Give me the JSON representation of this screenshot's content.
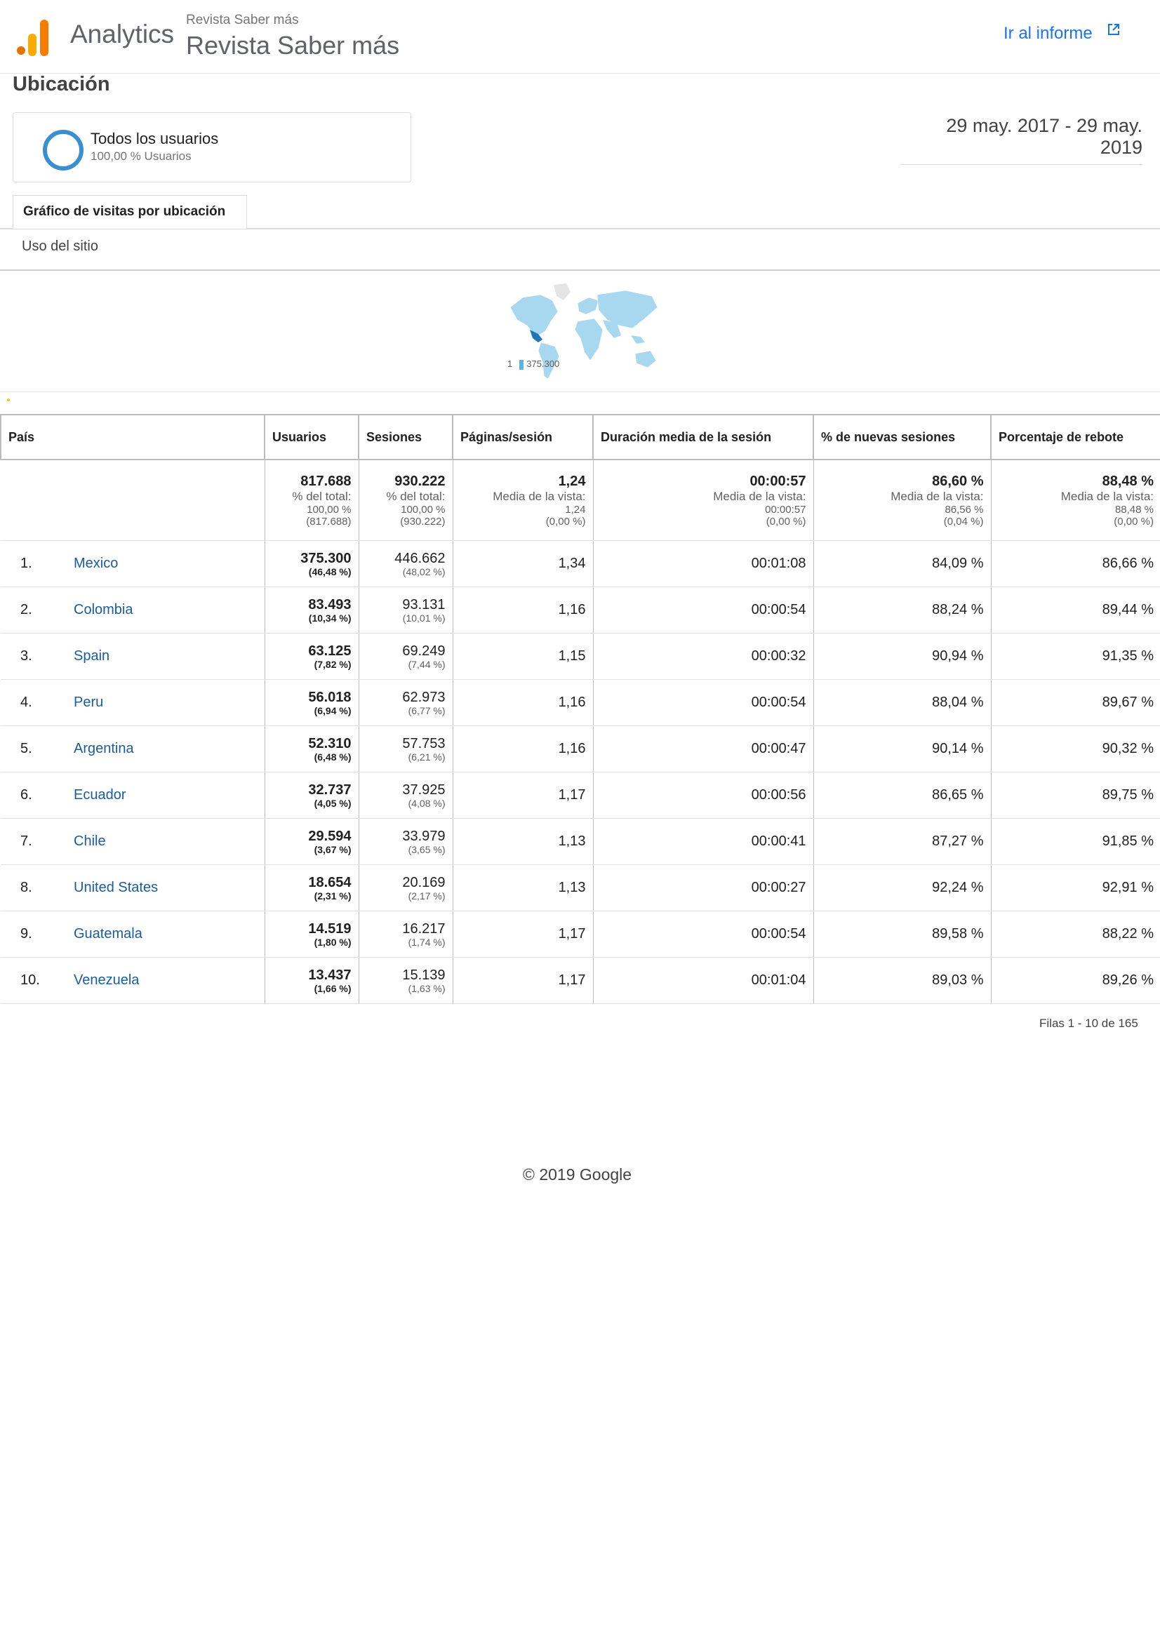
{
  "header": {
    "brand": "Analytics",
    "account_small": "Revista Saber más",
    "account_big": "Revista Saber más",
    "report_link": "Ir al informe"
  },
  "page_title": "Ubicación",
  "segment": {
    "name": "Todos los usuarios",
    "sub": "100,00 % Usuarios"
  },
  "date_range": "29 may. 2017 - 29 may. 2019",
  "tab": "Gráfico de visitas por ubicación",
  "subtab": "Uso del sitio",
  "map_legend": {
    "min": "1",
    "max": "375.300"
  },
  "table": {
    "headers": [
      "País",
      "Usuarios",
      "Sesiones",
      "Páginas/sesión",
      "Duración media de la sesión",
      "% de nuevas sesiones",
      "Porcentaje de rebote"
    ],
    "totals": [
      {
        "value": "817.688",
        "l1": "% del total:",
        "l2": "100,00 %",
        "l3": "(817.688)"
      },
      {
        "value": "930.222",
        "l1": "% del total:",
        "l2": "100,00 %",
        "l3": "(930.222)"
      },
      {
        "value": "1,24",
        "l1": "Media de la vista:",
        "l2": "1,24",
        "l3": "(0,00 %)"
      },
      {
        "value": "00:00:57",
        "l1": "Media de la vista:",
        "l2": "00:00:57",
        "l3": "(0,00 %)"
      },
      {
        "value": "86,60 %",
        "l1": "Media de la vista:",
        "l2": "86,56 %",
        "l3": "(0,04 %)"
      },
      {
        "value": "88,48 %",
        "l1": "Media de la vista:",
        "l2": "88,48 %",
        "l3": "(0,00 %)"
      }
    ],
    "rows": [
      {
        "idx": "1.",
        "country": "Mexico",
        "users": "375.300",
        "users_pct": "(46,48 %)",
        "sessions": "446.662",
        "sessions_pct": "(48,02 %)",
        "pages": "1,34",
        "duration": "00:01:08",
        "new": "84,09 %",
        "bounce": "86,66 %"
      },
      {
        "idx": "2.",
        "country": "Colombia",
        "users": "83.493",
        "users_pct": "(10,34 %)",
        "sessions": "93.131",
        "sessions_pct": "(10,01 %)",
        "pages": "1,16",
        "duration": "00:00:54",
        "new": "88,24 %",
        "bounce": "89,44 %"
      },
      {
        "idx": "3.",
        "country": "Spain",
        "users": "63.125",
        "users_pct": "(7,82 %)",
        "sessions": "69.249",
        "sessions_pct": "(7,44 %)",
        "pages": "1,15",
        "duration": "00:00:32",
        "new": "90,94 %",
        "bounce": "91,35 %"
      },
      {
        "idx": "4.",
        "country": "Peru",
        "users": "56.018",
        "users_pct": "(6,94 %)",
        "sessions": "62.973",
        "sessions_pct": "(6,77 %)",
        "pages": "1,16",
        "duration": "00:00:54",
        "new": "88,04 %",
        "bounce": "89,67 %"
      },
      {
        "idx": "5.",
        "country": "Argentina",
        "users": "52.310",
        "users_pct": "(6,48 %)",
        "sessions": "57.753",
        "sessions_pct": "(6,21 %)",
        "pages": "1,16",
        "duration": "00:00:47",
        "new": "90,14 %",
        "bounce": "90,32 %"
      },
      {
        "idx": "6.",
        "country": "Ecuador",
        "users": "32.737",
        "users_pct": "(4,05 %)",
        "sessions": "37.925",
        "sessions_pct": "(4,08 %)",
        "pages": "1,17",
        "duration": "00:00:56",
        "new": "86,65 %",
        "bounce": "89,75 %"
      },
      {
        "idx": "7.",
        "country": "Chile",
        "users": "29.594",
        "users_pct": "(3,67 %)",
        "sessions": "33.979",
        "sessions_pct": "(3,65 %)",
        "pages": "1,13",
        "duration": "00:00:41",
        "new": "87,27 %",
        "bounce": "91,85 %"
      },
      {
        "idx": "8.",
        "country": "United States",
        "users": "18.654",
        "users_pct": "(2,31 %)",
        "sessions": "20.169",
        "sessions_pct": "(2,17 %)",
        "pages": "1,13",
        "duration": "00:00:27",
        "new": "92,24 %",
        "bounce": "92,91 %"
      },
      {
        "idx": "9.",
        "country": "Guatemala",
        "users": "14.519",
        "users_pct": "(1,80 %)",
        "sessions": "16.217",
        "sessions_pct": "(1,74 %)",
        "pages": "1,17",
        "duration": "00:00:54",
        "new": "89,58 %",
        "bounce": "88,22 %"
      },
      {
        "idx": "10.",
        "country": "Venezuela",
        "users": "13.437",
        "users_pct": "(1,66 %)",
        "sessions": "15.139",
        "sessions_pct": "(1,63 %)",
        "pages": "1,17",
        "duration": "00:01:04",
        "new": "89,03 %",
        "bounce": "89,26 %"
      }
    ]
  },
  "pager": "Filas 1 - 10 de 165",
  "footer": "© 2019 Google",
  "colors": {
    "link": "#1a73e8",
    "country_link": "#1a5c9e",
    "segment_ring": "#3a8fd1",
    "map_fill": "#a8d8ef",
    "map_highlight": "#1f78b4"
  },
  "icons": {
    "logo": "analytics-logo-icon",
    "external": "external-link-icon",
    "segment": "segment-ring-icon"
  }
}
